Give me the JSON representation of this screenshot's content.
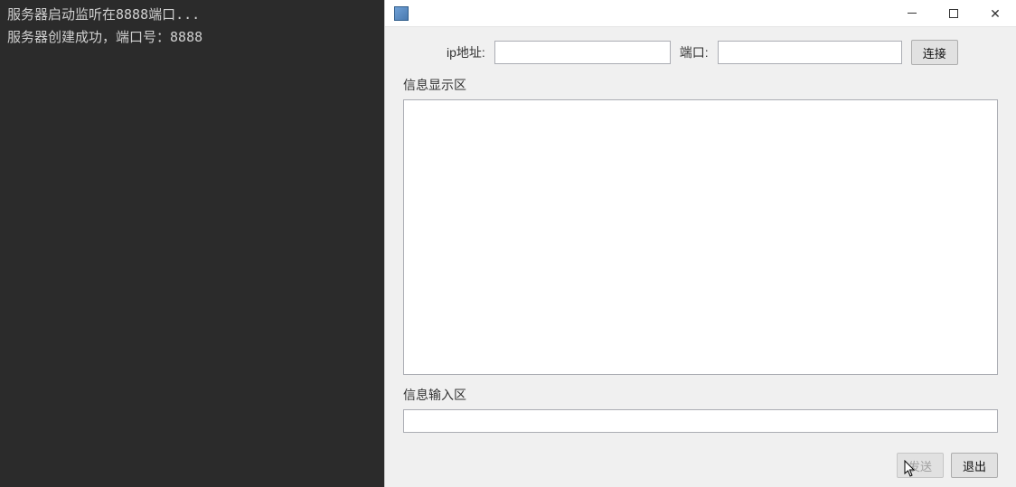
{
  "terminal": {
    "lines": [
      "服务器启动监听在8888端口...",
      "服务器创建成功，端口号：8888"
    ]
  },
  "window": {
    "titlebar": {
      "min_tooltip": "最小化",
      "max_tooltip": "最大化",
      "close_tooltip": "关闭"
    },
    "connect_row": {
      "ip_label": "ip地址:",
      "ip_value": "",
      "port_label": "端口:",
      "port_value": "",
      "connect_button": "连接"
    },
    "display_section": {
      "label": "信息显示区",
      "content": ""
    },
    "input_section": {
      "label": "信息输入区",
      "value": ""
    },
    "footer": {
      "send_button": "发送",
      "exit_button": "退出",
      "send_disabled": true
    }
  }
}
